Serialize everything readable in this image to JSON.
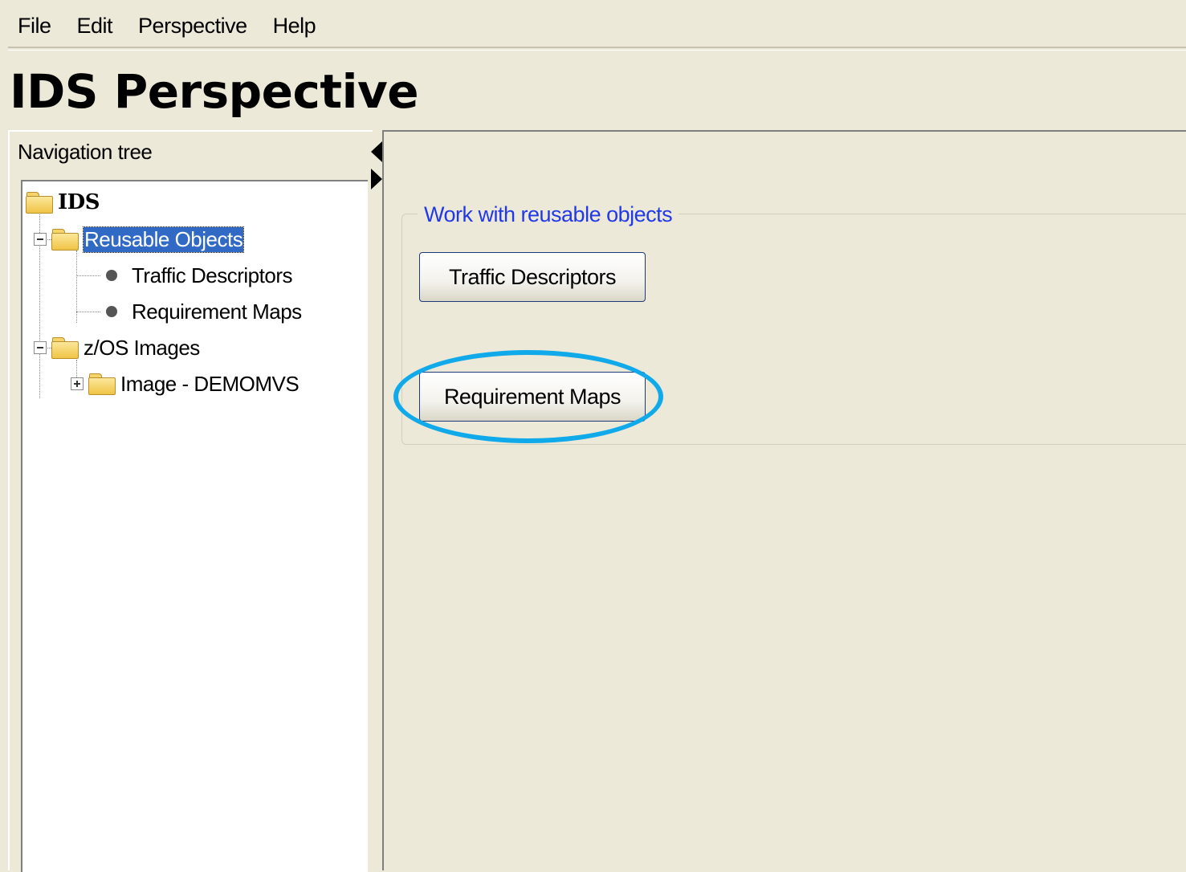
{
  "menu": [
    "File",
    "Edit",
    "Perspective",
    "Help"
  ],
  "page_title": "IDS Perspective",
  "nav": {
    "header": "Navigation tree",
    "tree": {
      "root": "IDS",
      "reusable_objects": "Reusable Objects",
      "traffic_descriptors": "Traffic Descriptors",
      "requirement_maps": "Requirement Maps",
      "zos_images": "z/OS Images",
      "image_demomvs": "Image - DEMOMVS"
    }
  },
  "content": {
    "group_title": "Work with reusable objects",
    "buttons": {
      "traffic_descriptors": "Traffic Descriptors",
      "requirement_maps": "Requirement Maps"
    }
  },
  "colors": {
    "background": "#ece9d8",
    "group_title": "#2138e8",
    "highlight": "#10a9ea",
    "selection": "#316ac5"
  },
  "selected_tree_item": "Reusable Objects",
  "highlighted_button": "Requirement Maps"
}
